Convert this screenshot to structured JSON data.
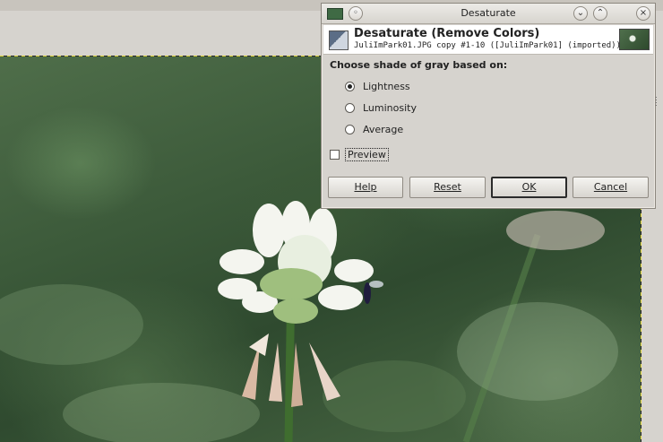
{
  "dialog": {
    "title": "Desaturate",
    "header_title": "Desaturate (Remove Colors)",
    "header_subtitle": "JuliImPark01.JPG copy #1-10 ([JuliImPark01] (imported))",
    "section_label": "Choose shade of gray based on:",
    "options": [
      {
        "label": "Lightness",
        "selected": true
      },
      {
        "label": "Luminosity",
        "selected": false
      },
      {
        "label": "Average",
        "selected": false
      }
    ],
    "preview": {
      "label": "Preview",
      "checked": false
    },
    "buttons": {
      "help": "Help",
      "reset": "Reset",
      "ok": "OK",
      "cancel": "Cancel"
    }
  },
  "icons": {
    "menu": "window-menu-icon",
    "minimize": "minimize-icon",
    "maximize": "maximize-icon",
    "close": "close-icon",
    "tool": "desaturate-tool-icon",
    "thumbnail": "image-thumbnail"
  }
}
